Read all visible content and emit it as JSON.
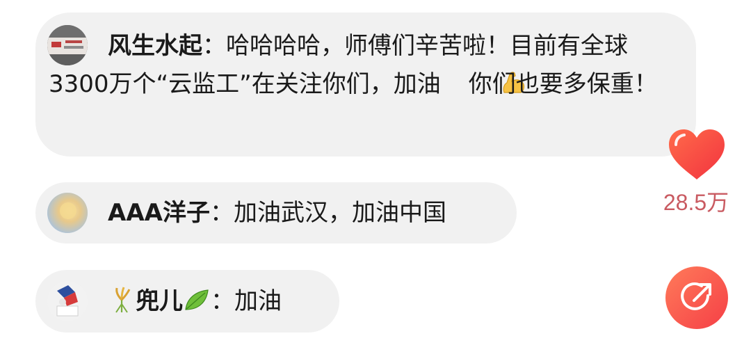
{
  "comments": [
    {
      "username": "风生水起",
      "separator": "：",
      "text_part1": "哈哈哈哈，师傅们辛苦啦！目前有全球3300万个“云监工”在关注你们，加油",
      "emoji_inline": "flexed-biceps-icon",
      "text_part2": "你们也要多保重！"
    },
    {
      "username": "AAA洋子",
      "separator": "：",
      "text": "加油武汉，加油中国"
    },
    {
      "username_prefix_emoji": "rice-sheaf-icon",
      "username": "兜儿",
      "username_suffix_emoji": "leaf-icon",
      "separator": "：",
      "text": "加油"
    }
  ],
  "like": {
    "icon": "heart-icon",
    "count": "28.5万"
  },
  "share": {
    "icon": "share-arrow-icon"
  },
  "colors": {
    "bubble_bg": "#f1f1f1",
    "like_count": "#c95a61",
    "heart_red": "#f84a4a",
    "share_orange": "#ff7b5a"
  }
}
